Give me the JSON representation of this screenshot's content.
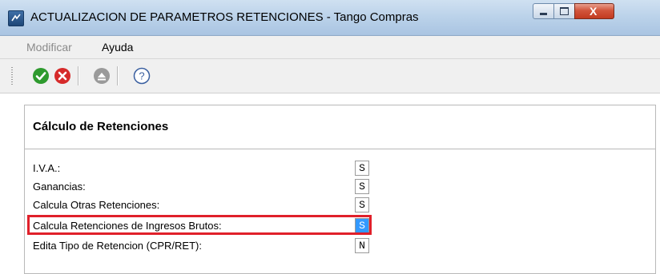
{
  "window": {
    "title": "ACTUALIZACION DE PARAMETROS RETENCIONES - Tango Compras",
    "close_glyph": "X"
  },
  "menubar": {
    "items": [
      {
        "label": "Modificar",
        "enabled": false
      },
      {
        "label": "Ayuda",
        "enabled": true
      }
    ]
  },
  "toolbar": {
    "buttons": [
      {
        "icon": "check-icon",
        "color": "#2e9a2e"
      },
      {
        "icon": "cancel-icon",
        "color": "#d62a2a"
      },
      {
        "icon": "eject-icon",
        "color": "#9a9a9a"
      },
      {
        "icon": "help-icon",
        "color": "#3a5fa0"
      }
    ]
  },
  "section": {
    "title": "Cálculo de Retenciones"
  },
  "rows": [
    {
      "label": "I.V.A.:",
      "value": "S"
    },
    {
      "label": "Ganancias:",
      "value": "S"
    },
    {
      "label": "Calcula Otras Retenciones:",
      "value": "S"
    },
    {
      "label": "Calcula Retenciones de Ingresos Brutos:",
      "value": "S",
      "selected": true
    },
    {
      "label": "Edita Tipo de Retencion (CPR/RET):",
      "value": "N"
    }
  ],
  "colors": {
    "highlight": "#e0202a",
    "selection": "#3399ff"
  }
}
